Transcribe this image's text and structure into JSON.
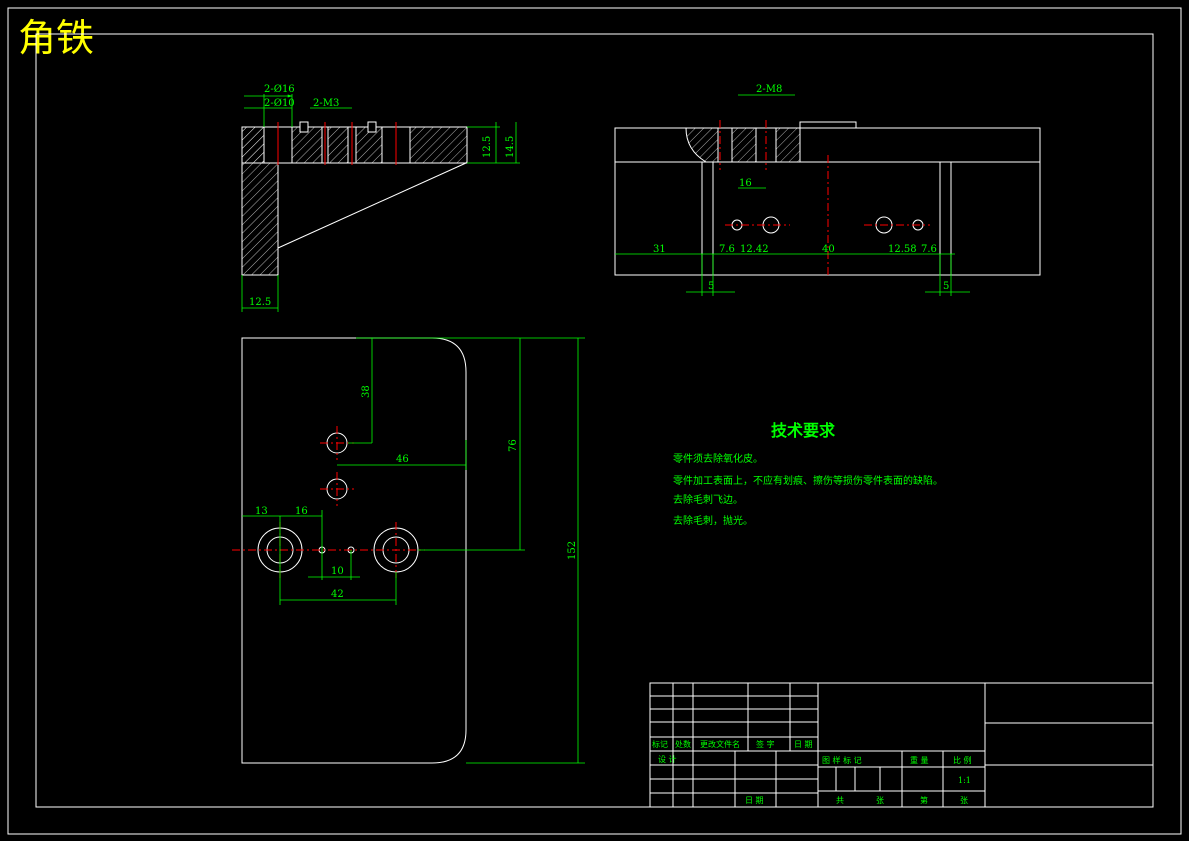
{
  "drawing_title": "角铁",
  "colors": {
    "background": "#000000",
    "outline": "#ffffff",
    "dimension": "#00ff00",
    "centerline": "#ff0000",
    "title": "#ffff00"
  },
  "side_view": {
    "dims": {
      "d16": "2-Ø16",
      "d10": "2-Ø10",
      "m3": "2-M3",
      "h125": "12.5",
      "h145": "14.5",
      "w125": "12.5"
    }
  },
  "front_view": {
    "dims": {
      "m8": "2-M8",
      "d16": "16",
      "d31": "31",
      "d76a": "7.6",
      "d1242": "12.42",
      "d40": "40",
      "d1258": "12.58",
      "d76b": "7.6",
      "d5a": "5",
      "d5b": "5"
    }
  },
  "top_view": {
    "dims": {
      "d38": "38",
      "d46": "46",
      "d76": "76",
      "d152": "152",
      "d13": "13",
      "d16": "16",
      "d10": "10",
      "d42": "42"
    }
  },
  "tech_requirements": {
    "heading": "技术要求",
    "items": [
      "零件须去除氧化皮。",
      "零件加工表面上，不应有划痕、擦伤等损伤零件表面的缺陷。",
      "去除毛刺飞边。",
      "去除毛刺，抛光。"
    ]
  },
  "title_block": {
    "rev_headers": [
      "标记",
      "处数",
      "更改文件名",
      "签 字",
      "日 期"
    ],
    "design": "设 计",
    "date": "日 期",
    "stage_headers": [
      "图 样 标 记",
      "重 量",
      "比 例"
    ],
    "scale": "1:1",
    "sheet": [
      "共",
      "张",
      "第",
      "张"
    ]
  }
}
